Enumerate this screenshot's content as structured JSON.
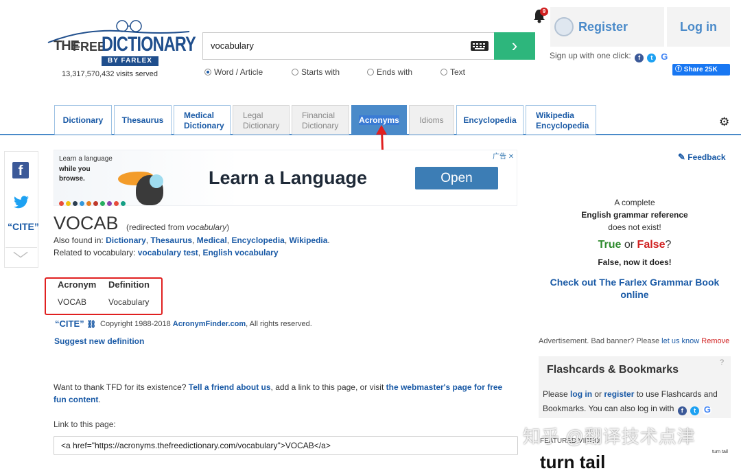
{
  "logo": {
    "the": "THE",
    "free": "FREE",
    "dictionary": "DICTIONARY",
    "by": "BY FARLEX",
    "visits": "13,317,570,432 visits served"
  },
  "search": {
    "value": "vocabulary",
    "button_glyph": "›",
    "options": [
      {
        "label": "Word / Article",
        "selected": true
      },
      {
        "label": "Starts with",
        "selected": false
      },
      {
        "label": "Ends with",
        "selected": false
      },
      {
        "label": "Text",
        "selected": false
      }
    ]
  },
  "account": {
    "notification_count": "9",
    "register": "Register",
    "login": "Log in",
    "signup": "Sign up with one click:",
    "share": "Share 25K"
  },
  "tabs": [
    {
      "line1": "Dictionary",
      "line2": ""
    },
    {
      "line1": "Thesaurus",
      "line2": ""
    },
    {
      "line1": "Medical",
      "line2": "Dictionary"
    },
    {
      "line1": "Legal",
      "line2": "Dictionary"
    },
    {
      "line1": "Financial",
      "line2": "Dictionary"
    },
    {
      "line1": "Acronyms",
      "line2": ""
    },
    {
      "line1": "Idioms",
      "line2": ""
    },
    {
      "line1": "Encyclopedia",
      "line2": ""
    },
    {
      "line1": "Wikipedia",
      "line2": "Encyclopedia"
    }
  ],
  "sidebar": {
    "cite": "“CITE”"
  },
  "ad": {
    "small1": "Learn a language",
    "small2": "while you browse.",
    "headline": "Learn a Language",
    "button": "Open",
    "tag": "广告 ✕"
  },
  "entry": {
    "word": "VOCAB",
    "redirect_prefix": "(redirected from ",
    "redirect_word": "vocabulary",
    "redirect_suffix": ")",
    "also_prefix": "Also found in: ",
    "also_links": [
      "Dictionary",
      "Thesaurus",
      "Medical",
      "Encyclopedia",
      "Wikipedia"
    ],
    "related_prefix": "Related to vocabulary: ",
    "related_links": [
      "vocabulary test",
      "English vocabulary"
    ]
  },
  "table": {
    "headers": [
      "Acronym",
      "Definition"
    ],
    "rows": [
      [
        "VOCAB",
        "Vocabulary"
      ]
    ]
  },
  "cite_block": {
    "cite": "“CITE”",
    "copyright_prefix": "Copyright 1988-2018 ",
    "copyright_link": "AcronymFinder.com",
    "copyright_suffix": ", All rights reserved.",
    "suggest": "Suggest new definition"
  },
  "footer": {
    "thanks_prefix": "Want to thank TFD for its existence? ",
    "thanks_link1": "Tell a friend about us",
    "thanks_mid": ", add a link to this page, or visit ",
    "thanks_link2": "the webmaster's page for free fun content",
    "thanks_end": ".",
    "link_label": "Link to this page:",
    "link_code": "<a href=\"https://acronyms.thefreedictionary.com/vocabulary\">VOCAB</a>"
  },
  "right": {
    "feedback": "Feedback",
    "g1": "A complete",
    "g2": "English grammar reference",
    "g3": "does not exist!",
    "g4_true": "True",
    "g4_or": " or ",
    "g4_false": "False",
    "g4_q": "?",
    "g5": "False, now it does!",
    "g6": "Check out The Farlex Grammar Book online",
    "adnote_prefix": "Advertisement. Bad banner? Please ",
    "adnote_link": "let us know",
    "adnote_remove": " Remove",
    "fc_title": "Flashcards & Bookmarks",
    "fc_q": "?",
    "fc_please": "Please ",
    "fc_login": "log in",
    "fc_or": " or ",
    "fc_register": "register",
    "fc_rest": " to use Flashcards and Bookmarks. You can also log in with",
    "featured": "FEATURED VIDEO",
    "turntail": "turn tail",
    "turntail_small": "turn tail"
  },
  "watermark": "知乎 @翻译技术点津",
  "colors": {
    "brand_blue": "#1a5aa6",
    "tab_active": "#4a8ac9",
    "search_green": "#2db67c",
    "annotation_red": "#e02020"
  }
}
